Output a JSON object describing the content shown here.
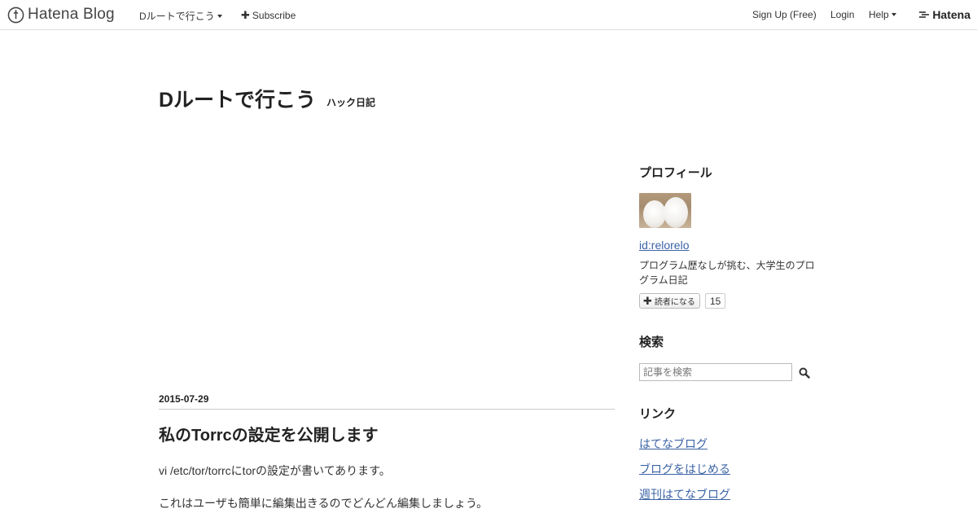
{
  "global_header": {
    "logo_text": "Hatena Blog",
    "blog_menu_label": "Dルートで行こう",
    "subscribe_label": "Subscribe",
    "signup_label": "Sign Up (Free)",
    "login_label": "Login",
    "help_label": "Help",
    "brand_label": "Hatena"
  },
  "blog": {
    "title": "Dルートで行こう",
    "description": "ハック日記"
  },
  "entry": {
    "date": "2015-07-29",
    "title": "私のTorrcの設定を公開します",
    "paragraphs": [
      "vi /etc/tor/torrcにtorの設定が書いてあります。",
      "これはユーザも簡単に編集出きるのでどんどん編集しましょう。"
    ]
  },
  "sidebar": {
    "profile": {
      "heading": "プロフィール",
      "user_id": "id:relorelo",
      "bio": "プログラム歴なしが挑む、大学生のプログラム日記",
      "subscribe_label": "読者になる",
      "subscriber_count": "15"
    },
    "search": {
      "heading": "検索",
      "placeholder": "記事を検索"
    },
    "links": {
      "heading": "リンク",
      "items": [
        "はてなブログ",
        "ブログをはじめる",
        "週刊はてなブログ"
      ]
    }
  },
  "colors": {
    "link": "#3b63a5",
    "text": "#333333",
    "border": "#dddddd"
  }
}
